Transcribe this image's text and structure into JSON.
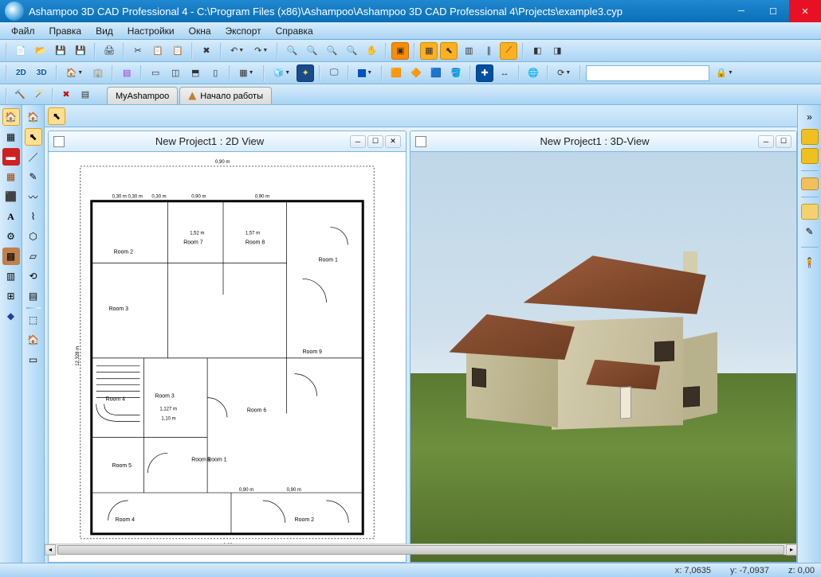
{
  "window": {
    "title": "Ashampoo 3D CAD Professional 4 - C:\\Program Files (x86)\\Ashampoo\\Ashampoo 3D CAD Professional 4\\Projects\\example3.cyp"
  },
  "menu": {
    "file": "Файл",
    "edit": "Правка",
    "view": "Вид",
    "settings": "Настройки",
    "windows": "Окна",
    "export": "Экспорт",
    "help": "Справка"
  },
  "tabs": {
    "tab1": "MyAshampoo",
    "tab2": "Начало работы"
  },
  "mode": {
    "mode2d": "2D",
    "mode3d": "3D"
  },
  "views": {
    "view2d_title": "New Project1 : 2D View",
    "view3d_title": "New Project1 : 3D-View"
  },
  "plan": {
    "dims": {
      "d1": "0,90 m",
      "d2": "0,90 m",
      "d3": "0,90 m",
      "d4": "0,90 m",
      "d5": "0,90 m",
      "d6": "0,90 m",
      "d7": "0,90 m",
      "d8": "0,30 m",
      "d9": "0,30 m",
      "d10": "0,30 m",
      "d11": "1,57 m",
      "d12": "1,52 m",
      "d13": "12,328 m",
      "d14": "1,127 m",
      "d15": "1,10 m"
    },
    "rooms": {
      "r1": "Room 1",
      "r1b": "Room 1",
      "r1c": "Room 1",
      "r2": "Room 2",
      "r2b": "Room 2",
      "r3": "Room 3",
      "r3b": "Room 3",
      "r4": "Room 4",
      "r4b": "Room 4",
      "r5": "Room 5",
      "r6": "Room 6",
      "r7": "Room 7",
      "r8": "Room 8",
      "r9": "Room 9"
    }
  },
  "status": {
    "x_label": "x:",
    "x_value": "7,0635",
    "y_label": "y:",
    "y_value": "-7,0937",
    "z_label": "z:",
    "z_value": "0,00"
  }
}
